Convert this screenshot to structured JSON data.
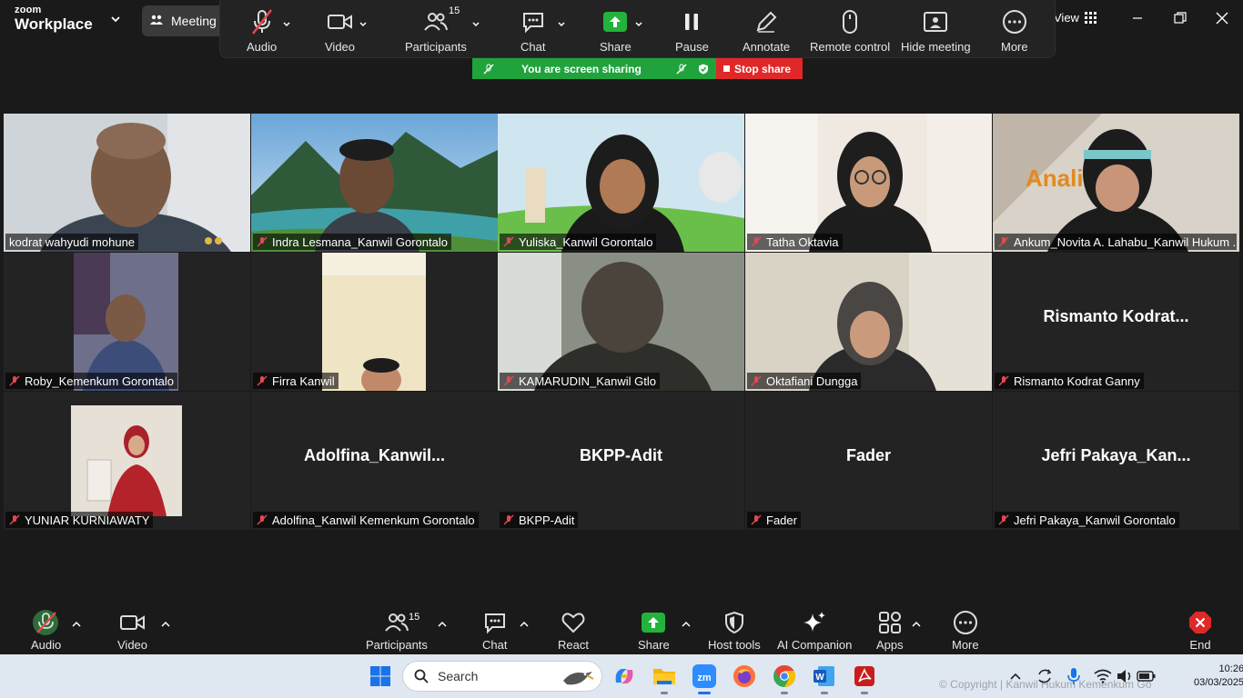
{
  "app": {
    "logo_line1": "zoom",
    "logo_line2": "Workplace",
    "meeting_tab": "Meeting",
    "view_label": "View"
  },
  "share_toolbar": {
    "audio": "Audio",
    "video": "Video",
    "participants": "Participants",
    "participants_count": "15",
    "chat": "Chat",
    "share": "Share",
    "pause": "Pause",
    "annotate": "Annotate",
    "remote_control": "Remote control",
    "hide_meeting": "Hide meeting",
    "more": "More"
  },
  "sharing_banner": {
    "text": "You are screen sharing",
    "stop": "Stop share"
  },
  "participants": [
    {
      "name": "kodrat wahyudi mohune",
      "muted": false,
      "active": true,
      "video": "photo"
    },
    {
      "name": "Indra Lesmana_Kanwil Gorontalo",
      "muted": true,
      "video": "photo"
    },
    {
      "name": "Yuliska_Kanwil Gorontalo",
      "muted": true,
      "video": "photo"
    },
    {
      "name": "Tatha Oktavia",
      "muted": true,
      "video": "photo"
    },
    {
      "name": "Ankum_Novita A. Lahabu_Kanwil Hukum ...",
      "muted": true,
      "video": "photo",
      "bg_text": "Anali"
    },
    {
      "name": "Roby_Kemenkum Gorontalo",
      "muted": true,
      "video": "thumb"
    },
    {
      "name": "Firra Kanwil",
      "muted": true,
      "video": "thumb"
    },
    {
      "name": "KAMARUDIN_Kanwil Gtlo",
      "muted": true,
      "video": "photo"
    },
    {
      "name": "Oktafiani Dungga",
      "muted": true,
      "video": "photo"
    },
    {
      "name": "Rismanto Kodrat Ganny",
      "muted": true,
      "video": "off",
      "display": "Rismanto  Kodrat..."
    },
    {
      "name": "YUNIAR KURNIAWATY",
      "muted": true,
      "video": "thumb"
    },
    {
      "name": "Adolfina_Kanwil Kemenkum Gorontalo",
      "muted": true,
      "video": "off",
      "display": "Adolfina_Kanwil..."
    },
    {
      "name": "BKPP-Adit",
      "muted": true,
      "video": "off",
      "display": "BKPP-Adit"
    },
    {
      "name": "Fader",
      "muted": true,
      "video": "off",
      "display": "Fader"
    },
    {
      "name": "Jefri Pakaya_Kanwil Gorontalo",
      "muted": true,
      "video": "off",
      "display": "Jefri  Pakaya_Kan..."
    }
  ],
  "controls": {
    "audio": "Audio",
    "video": "Video",
    "participants": "Participants",
    "participants_count": "15",
    "chat": "Chat",
    "react": "React",
    "share": "Share",
    "host_tools": "Host tools",
    "ai_companion": "AI Companion",
    "apps": "Apps",
    "more": "More",
    "end": "End"
  },
  "taskbar": {
    "search_placeholder": "Search",
    "time": "10:26",
    "date": "03/03/2025",
    "watermark": "© Copyright | Kanwil Hukum Kemenkum Go"
  },
  "colors": {
    "active_border": "#22c55e",
    "sharing_green": "#20a33d",
    "stop_red": "#e02828",
    "share_green": "#23b33c",
    "mute_red": "#e5484d"
  }
}
